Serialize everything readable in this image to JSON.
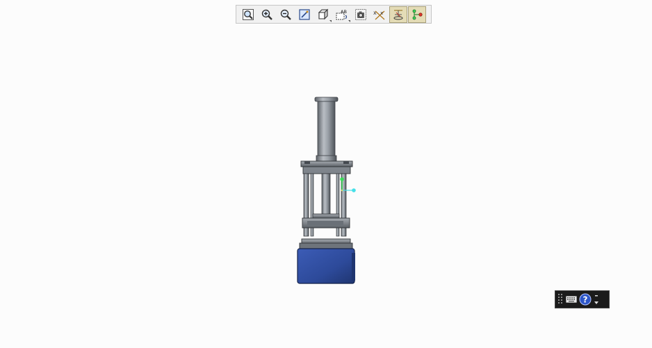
{
  "toolbar": {
    "buttons": [
      {
        "name": "zoom-fit-icon",
        "active": false
      },
      {
        "name": "zoom-in-icon",
        "active": false
      },
      {
        "name": "zoom-out-icon",
        "active": false
      },
      {
        "name": "repaint-icon",
        "active": false
      },
      {
        "name": "view-cube-icon",
        "active": false
      },
      {
        "name": "saved-views-icon",
        "active": false
      },
      {
        "name": "snapshot-icon",
        "active": false
      },
      {
        "name": "datum-display-icon",
        "active": false
      },
      {
        "name": "spin-center-icon",
        "active": true
      },
      {
        "name": "annotation-display-icon",
        "active": true
      }
    ],
    "view_label_text": "AB"
  },
  "colors": {
    "background": "#fcfcfc",
    "model_base_blue": "#2d4a9a",
    "model_steel": "#8a8f96",
    "handle_green": "#3cdc5a",
    "handle_cyan": "#46e0e8"
  },
  "mini_toolbar": {
    "items": [
      {
        "name": "grip-icon"
      },
      {
        "name": "keyboard-icon"
      },
      {
        "name": "help-icon",
        "text": "?"
      },
      {
        "name": "expand-arrows-icon"
      }
    ]
  }
}
